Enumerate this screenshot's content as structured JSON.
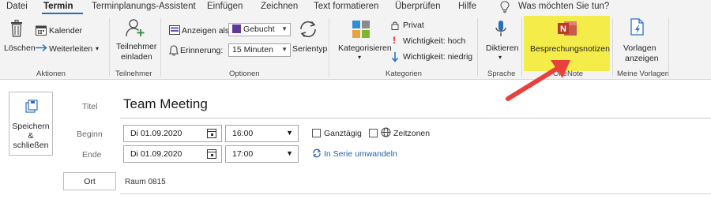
{
  "tabs": [
    "Datei",
    "Termin",
    "Terminplanungs-Assistent",
    "Einfügen",
    "Zeichnen",
    "Text formatieren",
    "Überprüfen",
    "Hilfe"
  ],
  "active_tab": "Termin",
  "search": {
    "text": "Was möchten Sie tun?"
  },
  "ribbon": {
    "aktionen": {
      "delete_label": "Löschen",
      "calendar_label": "Kalender",
      "forward_label": "Weiterleiten",
      "group": "Aktionen"
    },
    "teilnehmer": {
      "invite_line1": "Teilnehmer",
      "invite_line2": "einladen",
      "group": "Teilnehmer"
    },
    "optionen": {
      "show_as_label": "Anzeigen als:",
      "show_as_value": "Gebucht",
      "reminder_label": "Erinnerung:",
      "reminder_value": "15 Minuten",
      "recurrence_label": "Serientyp",
      "group": "Optionen"
    },
    "kategorien": {
      "categorize_label": "Kategorisieren",
      "private_label": "Privat",
      "high_label": "Wichtigkeit: hoch",
      "low_label": "Wichtigkeit: niedrig",
      "group": "Kategorien"
    },
    "sprache": {
      "dictate_label": "Diktieren",
      "group": "Sprache"
    },
    "onenote": {
      "notes_label": "Besprechungsnotizen",
      "group": "OneNote",
      "highlight_color": "#f4ec49"
    },
    "vorlagen": {
      "line1": "Vorlagen",
      "line2": "anzeigen",
      "group": "Meine Vorlagen"
    }
  },
  "form": {
    "save_line1": "Speichern",
    "save_line2": "&",
    "save_line3": "schließen",
    "title_label": "Titel",
    "title_value": "Team Meeting",
    "start_label": "Beginn",
    "start_date": "Di 01.09.2020",
    "start_time": "16:00",
    "end_label": "Ende",
    "end_date": "Di 01.09.2020",
    "end_time": "17:00",
    "allday_label": "Ganztägig",
    "timezones_label": "Zeitzonen",
    "series_link": "In Serie umwandeln",
    "location_button": "Ort",
    "location_value": "Raum 0815"
  },
  "colors": {
    "accent": "#1e6fbf",
    "arrow": "#e8413c",
    "onenote": "#b83c27"
  }
}
